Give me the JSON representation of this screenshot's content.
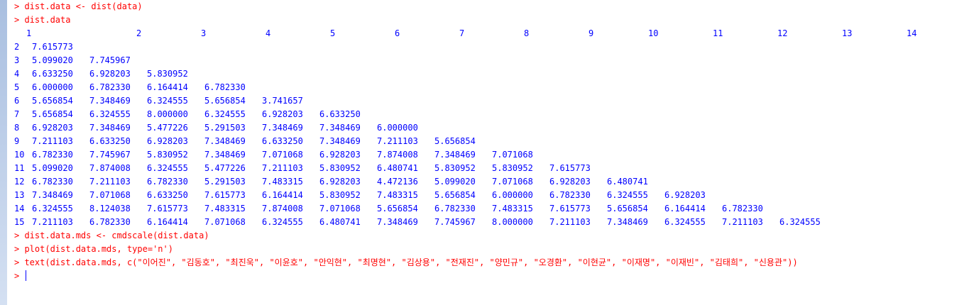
{
  "prompt": "> ",
  "colors": {
    "command": "#ff0000",
    "output": "#0000ff"
  },
  "commands_before": [
    "dist.data <- dist(data)",
    "dist.data"
  ],
  "dist_header": [
    "1",
    "2",
    "3",
    "4",
    "5",
    "6",
    "7",
    "8",
    "9",
    "10",
    "11",
    "12",
    "13",
    "14"
  ],
  "dist_rows": [
    {
      "label": "2",
      "values": [
        "7.615773"
      ]
    },
    {
      "label": "3",
      "values": [
        "5.099020",
        "7.745967"
      ]
    },
    {
      "label": "4",
      "values": [
        "6.633250",
        "6.928203",
        "5.830952"
      ]
    },
    {
      "label": "5",
      "values": [
        "6.000000",
        "6.782330",
        "6.164414",
        "6.782330"
      ]
    },
    {
      "label": "6",
      "values": [
        "5.656854",
        "7.348469",
        "6.324555",
        "5.656854",
        "3.741657"
      ]
    },
    {
      "label": "7",
      "values": [
        "5.656854",
        "6.324555",
        "8.000000",
        "6.324555",
        "6.928203",
        "6.633250"
      ]
    },
    {
      "label": "8",
      "values": [
        "6.928203",
        "7.348469",
        "5.477226",
        "5.291503",
        "7.348469",
        "7.348469",
        "6.000000"
      ]
    },
    {
      "label": "9",
      "values": [
        "7.211103",
        "6.633250",
        "6.928203",
        "7.348469",
        "6.633250",
        "7.348469",
        "7.211103",
        "5.656854"
      ]
    },
    {
      "label": "10",
      "values": [
        "6.782330",
        "7.745967",
        "5.830952",
        "7.348469",
        "7.071068",
        "6.928203",
        "7.874008",
        "7.348469",
        "7.071068"
      ]
    },
    {
      "label": "11",
      "values": [
        "5.099020",
        "7.874008",
        "6.324555",
        "5.477226",
        "7.211103",
        "5.830952",
        "6.480741",
        "5.830952",
        "5.830952",
        "7.615773"
      ]
    },
    {
      "label": "12",
      "values": [
        "6.782330",
        "7.211103",
        "6.782330",
        "5.291503",
        "7.483315",
        "6.928203",
        "4.472136",
        "5.099020",
        "7.071068",
        "6.928203",
        "6.480741"
      ]
    },
    {
      "label": "13",
      "values": [
        "7.348469",
        "7.071068",
        "6.633250",
        "7.615773",
        "6.164414",
        "5.830952",
        "7.483315",
        "5.656854",
        "6.000000",
        "6.782330",
        "6.324555",
        "6.928203"
      ]
    },
    {
      "label": "14",
      "values": [
        "6.324555",
        "8.124038",
        "7.615773",
        "7.483315",
        "7.874008",
        "7.071068",
        "5.656854",
        "6.782330",
        "7.483315",
        "7.615773",
        "5.656854",
        "6.164414",
        "6.782330"
      ]
    },
    {
      "label": "15",
      "values": [
        "7.211103",
        "6.782330",
        "6.164414",
        "7.071068",
        "6.324555",
        "6.480741",
        "7.348469",
        "7.745967",
        "8.000000",
        "7.211103",
        "7.348469",
        "6.324555",
        "7.211103",
        "6.324555"
      ]
    }
  ],
  "commands_after": [
    "dist.data.mds <- cmdscale(dist.data)",
    "plot(dist.data.mds, type='n')",
    "text(dist.data.mds, c(\"이어진\", \"김동호\", \"최진욱\", \"이윤호\", \"안익현\", \"최명현\", \"김상용\", \"전재진\", \"양민규\", \"오경환\", \"이현균\", \"이재명\", \"이재빈\", \"김태희\", \"신용관\"))"
  ],
  "input_line": ""
}
